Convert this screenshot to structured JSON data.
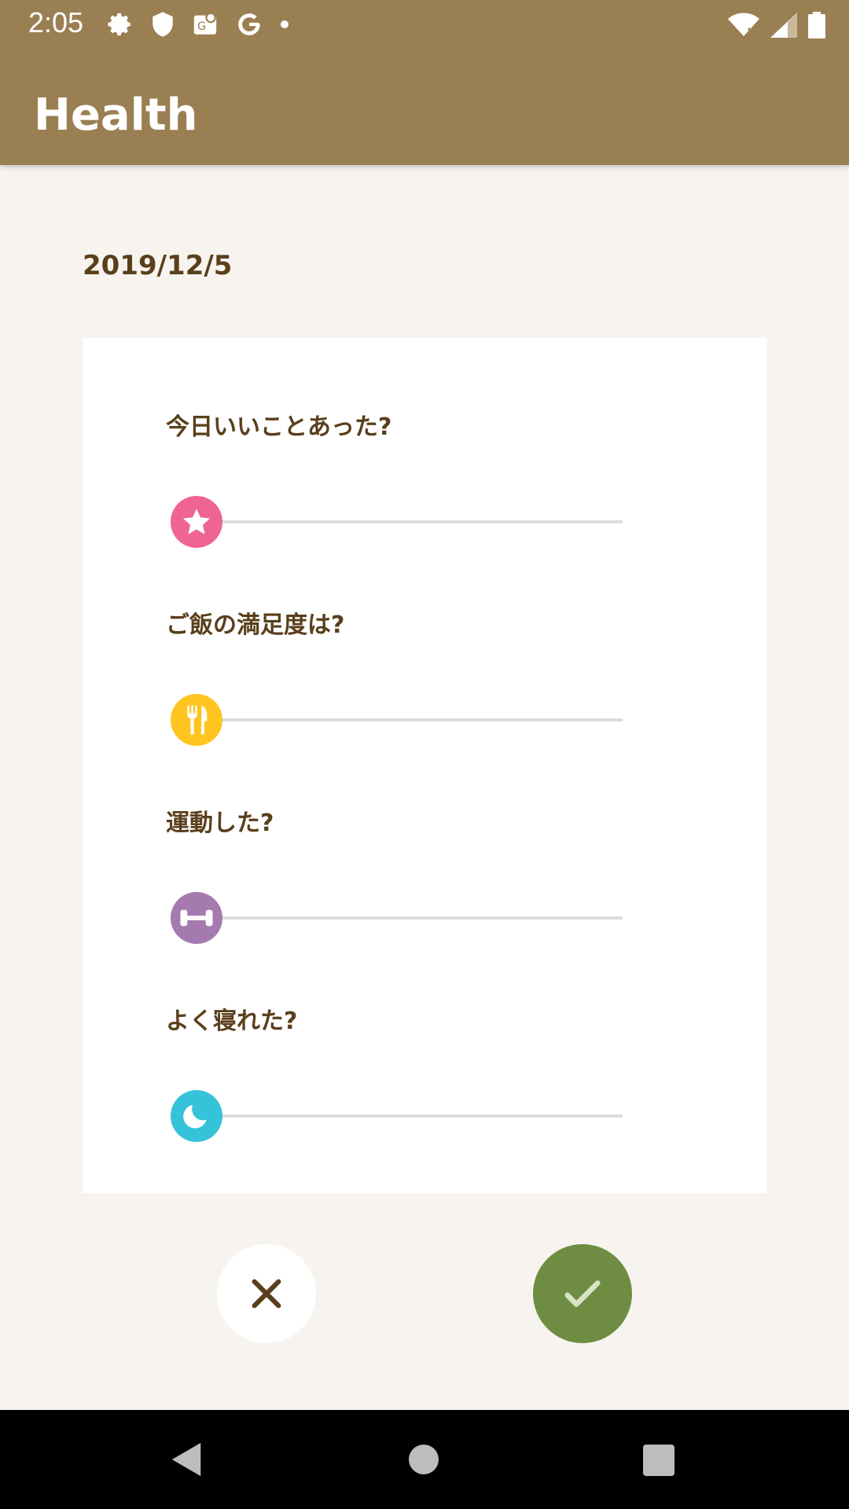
{
  "status_bar": {
    "time": "2:05",
    "left_icons": [
      "settings-icon",
      "shield-icon",
      "maps-icon",
      "google-icon",
      "dot-icon"
    ],
    "right_icons": [
      "wifi-icon",
      "signal-icon",
      "battery-icon"
    ]
  },
  "app_bar": {
    "title": "Health"
  },
  "entry": {
    "date": "2019/12/5"
  },
  "questions": [
    {
      "label": "今日いいことあった?",
      "icon": "star-icon",
      "color": "#f06493",
      "value": 0
    },
    {
      "label": "ご飯の満足度は?",
      "icon": "fork-knife-icon",
      "color": "#ffc41f",
      "value": 0
    },
    {
      "label": "運動した?",
      "icon": "dumbbell-icon",
      "color": "#a57aae",
      "value": 0
    },
    {
      "label": "よく寝れた?",
      "icon": "moon-icon",
      "color": "#35c3d9",
      "value": 0
    }
  ],
  "actions": {
    "cancel_icon": "close-icon",
    "confirm_icon": "check-icon",
    "confirm_color": "#6e8d42"
  },
  "colors": {
    "app_bar": "#9a7f52",
    "background": "#f7f4ef",
    "text": "#5a3f1c"
  }
}
